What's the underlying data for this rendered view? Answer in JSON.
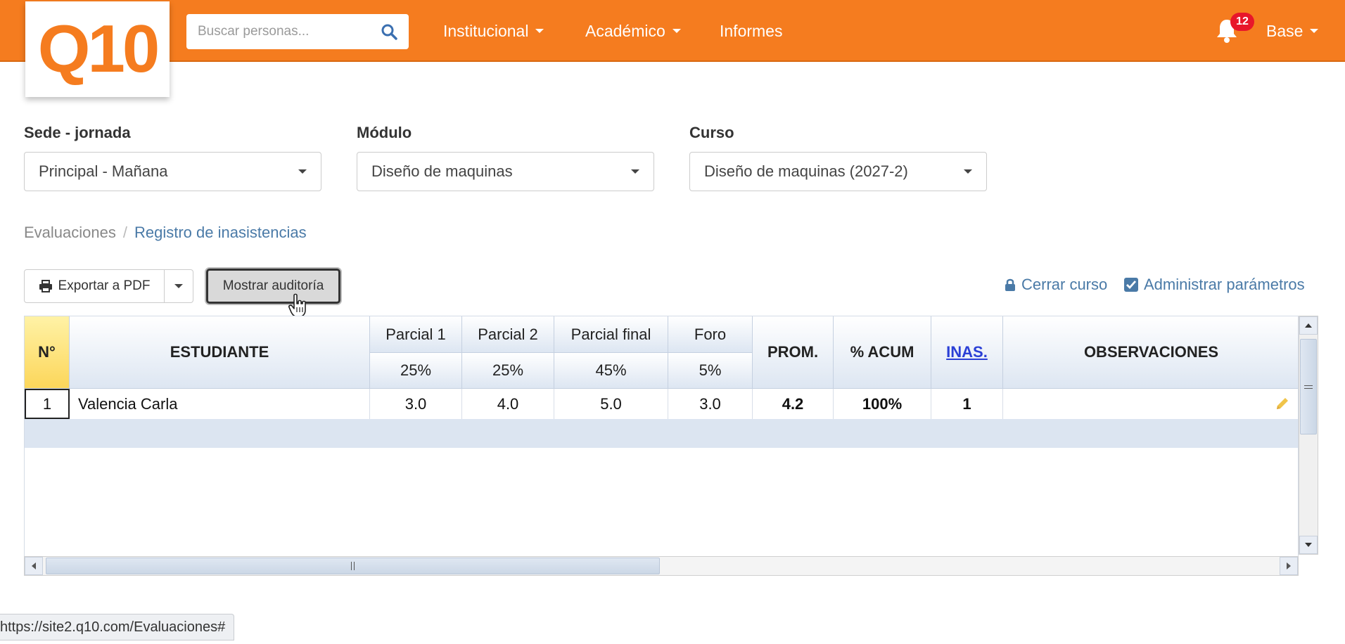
{
  "app": {
    "logo_text": "Q10",
    "brand_color": "#f57c1f"
  },
  "search": {
    "placeholder": "Buscar personas..."
  },
  "nav": {
    "items": [
      {
        "label": "Institucional",
        "has_dropdown": true
      },
      {
        "label": "Académico",
        "has_dropdown": true
      },
      {
        "label": "Informes",
        "has_dropdown": false
      }
    ],
    "notifications_count": "12",
    "user_label": "Base"
  },
  "filters": {
    "sede": {
      "label": "Sede - jornada",
      "value": "Principal - Mañana"
    },
    "modulo": {
      "label": "Módulo",
      "value": "Diseño de maquinas"
    },
    "curso": {
      "label": "Curso",
      "value": "Diseño de maquinas (2027-2)"
    }
  },
  "breadcrumb": {
    "items": [
      "Evaluaciones",
      "Registro de inasistencias"
    ],
    "separator": "/"
  },
  "toolbar": {
    "export_label": "Exportar a PDF",
    "audit_label": "Mostrar auditoría",
    "close_course_label": "Cerrar curso",
    "params_label": "Administrar parámetros"
  },
  "grid": {
    "headers": {
      "no": "N°",
      "student": "ESTUDIANTE",
      "evaluations": [
        {
          "name": "Parcial 1",
          "weight": "25%"
        },
        {
          "name": "Parcial 2",
          "weight": "25%"
        },
        {
          "name": "Parcial final",
          "weight": "45%"
        },
        {
          "name": "Foro",
          "weight": "5%"
        }
      ],
      "prom": "PROM.",
      "acum": "% ACUM",
      "inas": "INAS.",
      "obs": "OBSERVACIONES"
    },
    "rows": [
      {
        "no": "1",
        "student": "Valencia Carla",
        "grades": [
          "3.0",
          "4.0",
          "5.0",
          "3.0"
        ],
        "prom": "4.2",
        "acum": "100%",
        "inas": "1",
        "obs": ""
      }
    ]
  },
  "status_bar": {
    "url": "https://site2.q10.com/Evaluaciones#"
  }
}
